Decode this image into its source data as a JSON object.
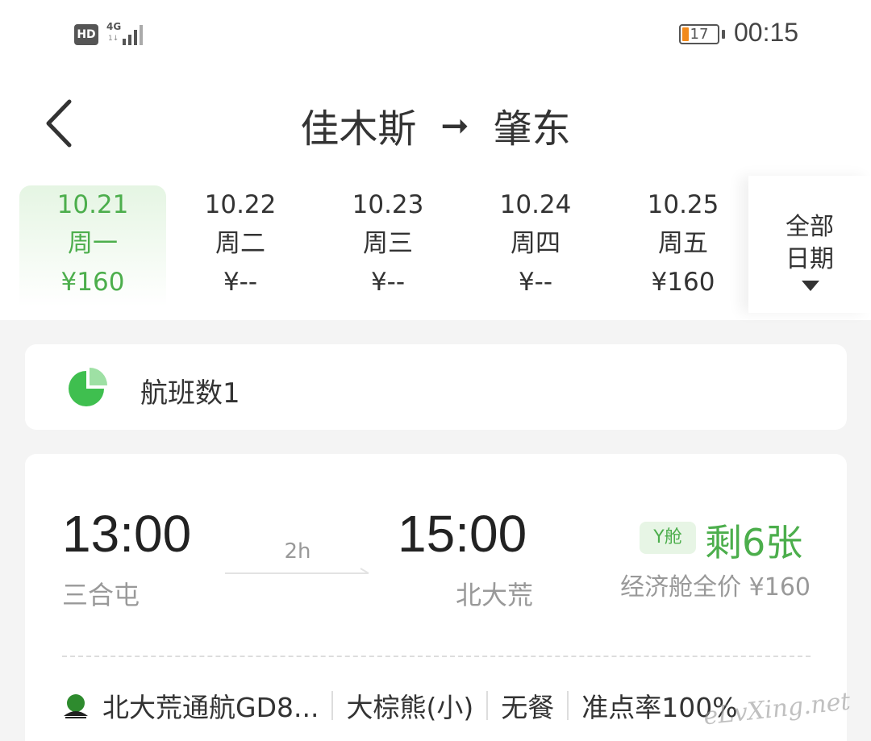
{
  "status_bar": {
    "hd_label": "HD",
    "network_label": "4G",
    "network_sub": "1↓",
    "battery_level": "17",
    "time": "00:15"
  },
  "header": {
    "origin": "佳木斯",
    "arrow": "➞",
    "destination": "肇东"
  },
  "dates": [
    {
      "date": "10.21",
      "weekday": "周一",
      "price": "¥160",
      "selected": true
    },
    {
      "date": "10.22",
      "weekday": "周二",
      "price": "¥--",
      "selected": false
    },
    {
      "date": "10.23",
      "weekday": "周三",
      "price": "¥--",
      "selected": false
    },
    {
      "date": "10.24",
      "weekday": "周四",
      "price": "¥--",
      "selected": false
    },
    {
      "date": "10.25",
      "weekday": "周五",
      "price": "¥160",
      "selected": false
    }
  ],
  "all_dates": {
    "line1": "全部",
    "line2": "日期"
  },
  "summary": {
    "flight_count_label": "航班数1"
  },
  "flight": {
    "dep_time": "13:00",
    "dep_airport": "三合屯",
    "duration": "2h",
    "arr_time": "15:00",
    "arr_airport": "北大荒",
    "cabin": "Y舱",
    "seats_left": "剩6张",
    "price_desc": "经济舱全价 ¥160",
    "airline": "北大荒通航GD8...",
    "aircraft": "大棕熊(小)",
    "meal": "无餐",
    "on_time": "准点率100%"
  },
  "watermark": "eLvXing.net",
  "colors": {
    "accent_green": "#4cae4c",
    "battery_orange": "#f28a1c",
    "background": "#f4f4f4"
  }
}
